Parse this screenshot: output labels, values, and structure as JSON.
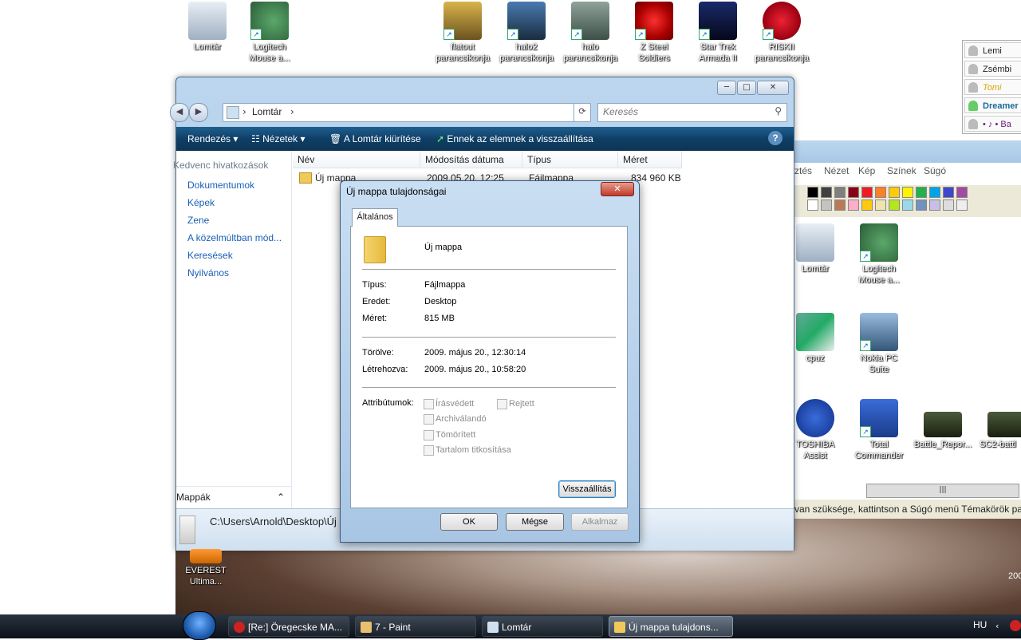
{
  "desktop_icons_top": [
    {
      "label_1": "Lomtár",
      "label_2": ""
    },
    {
      "label_1": "Logitech",
      "label_2": "Mouse a..."
    },
    {
      "label_1": "flatout",
      "label_2": "parancsikonja"
    },
    {
      "label_1": "halo2",
      "label_2": "parancsikonja"
    },
    {
      "label_1": "halo",
      "label_2": "parancsikonja"
    },
    {
      "label_1": "Z Steel",
      "label_2": "Soldiers"
    },
    {
      "label_1": "Star Trek",
      "label_2": "Armada II"
    },
    {
      "label_1": "RISKII",
      "label_2": "parancsikonja"
    }
  ],
  "desktop_icons_right": [
    {
      "label_1": "Lomtár",
      "label_2": ""
    },
    {
      "label_1": "Logitech",
      "label_2": "Mouse a..."
    },
    {
      "label_1": "cpuz",
      "label_2": ""
    },
    {
      "label_1": "Nokia PC",
      "label_2": "Suite"
    },
    {
      "label_1": "TOSHIBA",
      "label_2": "Assist"
    },
    {
      "label_1": "Total",
      "label_2": "Commander"
    },
    {
      "label_1": "Battle_Repor...",
      "label_2": ""
    },
    {
      "label_1": "SC2-battl",
      "label_2": ""
    }
  ],
  "desktop_icon_bottom": {
    "label_1": "EVEREST",
    "label_2": "Ultima..."
  },
  "messenger": {
    "contacts": [
      "Lemi",
      "Zsémbi",
      "Tomi",
      "Dreamer",
      "• ♪ • Ba"
    ]
  },
  "explorer": {
    "breadcrumb": "Lomtár",
    "search_placeholder": "Keresés",
    "toolbar": {
      "organize": "Rendezés",
      "views": "Nézetek",
      "empty": "A Lomtár kiürítése",
      "restore": "Ennek az elemnek a visszaállítása"
    },
    "nav_header": "Kedvenc hivatkozások",
    "nav_links": [
      "Dokumentumok",
      "Képek",
      "Zene",
      "A közelmúltban mód...",
      "Keresések",
      "Nyilvános"
    ],
    "folders_label": "Mappák",
    "columns": [
      "Név",
      "Módosítás dátuma",
      "Típus",
      "Méret"
    ],
    "rows": [
      {
        "name": "Új mappa",
        "date": "2009.05.20. 12:25",
        "type": "Fájlmappa",
        "size": "834 960 KB"
      }
    ],
    "status_path": "C:\\Users\\Arnold\\Desktop\\Új"
  },
  "paint": {
    "menu": [
      "ztés",
      "Nézet",
      "Kép",
      "Színek",
      "Súgó"
    ],
    "status": "van szüksége, kattintson a Súgó menü Témakörök par",
    "palette_top": [
      "#000000",
      "#404040",
      "#7f7f7f",
      "#880015",
      "#ed1c24",
      "#ff7f27",
      "#ffc90e",
      "#fff200",
      "#22b14c",
      "#00a2e8",
      "#3f48cc",
      "#a349a4"
    ],
    "palette_bottom": [
      "#ffffff",
      "#c3c3c3",
      "#b97a57",
      "#ffaec9",
      "#ffc90e",
      "#efe4b0",
      "#b5e61d",
      "#99d9ea",
      "#7092be",
      "#c8bfe7",
      "#dddddd",
      "#eeeeee"
    ]
  },
  "dialog": {
    "title": "Új mappa tulajdonságai",
    "tab": "Általános",
    "name": "Új mappa",
    "fields": [
      {
        "label": "Típus:",
        "value": "Fájlmappa"
      },
      {
        "label": "Eredet:",
        "value": "Desktop"
      },
      {
        "label": "Méret:",
        "value": "815 MB"
      }
    ],
    "dates": [
      {
        "label": "Törölve:",
        "value": "2009. május 20., 12:30:14"
      },
      {
        "label": "Létrehozva:",
        "value": "2009. május 20., 10:58:20"
      }
    ],
    "attributes_label": "Attribútumok:",
    "attributes": [
      "Írásvédett",
      "Rejtett",
      "Archiválandó",
      "Tömörített",
      "Tartalom titkosítása"
    ],
    "restore_button": "Visszaállítás",
    "ok": "OK",
    "cancel": "Mégse",
    "apply": "Alkalmaz"
  },
  "taskbar": {
    "buttons": [
      "[Re:] Öregecske MA...",
      "7 - Paint",
      "Lomtár",
      "Új mappa tulajdons..."
    ],
    "language": "HU",
    "clock_partial": "200"
  }
}
